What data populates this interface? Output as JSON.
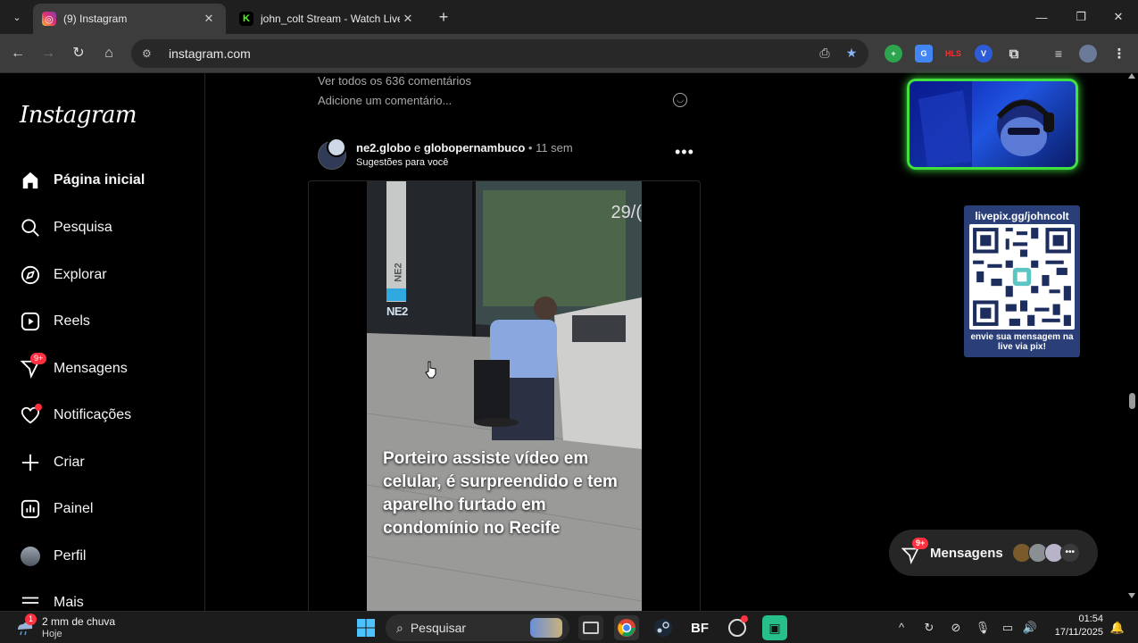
{
  "browser": {
    "tabs": [
      {
        "title": "(9) Instagram",
        "active": true
      },
      {
        "title": "john_colt Stream - Watch Live o",
        "active": false
      }
    ],
    "url": "instagram.com"
  },
  "sidebar": {
    "logo": "Instagram",
    "items": [
      {
        "label": "Página inicial",
        "icon": "home-icon",
        "active": true
      },
      {
        "label": "Pesquisa",
        "icon": "search-icon"
      },
      {
        "label": "Explorar",
        "icon": "compass-icon"
      },
      {
        "label": "Reels",
        "icon": "reels-icon"
      },
      {
        "label": "Mensagens",
        "icon": "messenger-icon",
        "badge": "9+"
      },
      {
        "label": "Notificações",
        "icon": "heart-icon",
        "dot": true
      },
      {
        "label": "Criar",
        "icon": "plus-icon"
      },
      {
        "label": "Painel",
        "icon": "dashboard-icon"
      },
      {
        "label": "Perfil",
        "icon": "avatar-icon"
      },
      {
        "label": "Mais",
        "icon": "menu-icon"
      }
    ]
  },
  "feed": {
    "view_comments": "Ver todos os 636 comentários",
    "add_comment_placeholder": "Adicione um comentário...",
    "post": {
      "author1": "ne2.globo",
      "conj": "e",
      "author2": "globopernambuco",
      "separator": "•",
      "time": "11 sem",
      "subtitle": "Sugestões para você",
      "video_logo": "NE2",
      "video_date": "29/(",
      "overlay_text": "Porteiro assiste vídeo em celular, é surpreendido e tem aparelho furtado em condomínio no Recife"
    }
  },
  "stream_overlay": {
    "pix_url": "livepix.gg/johncolt",
    "pix_caption": "envie sua mensagem na live via pix!"
  },
  "messages_pill": {
    "label": "Mensagens",
    "badge": "9+"
  },
  "taskbar": {
    "weather_badge": "1",
    "weather_temp": "2 mm de chuva",
    "weather_day": "Hoje",
    "search_placeholder": "Pesquisar",
    "time": "01:54",
    "date": "17/11/2025",
    "app_bf_label": "BF"
  },
  "colors": {
    "accent": "#ff3040",
    "webcam_border": "#3fe03f",
    "pix_card": "#2a3f78"
  }
}
